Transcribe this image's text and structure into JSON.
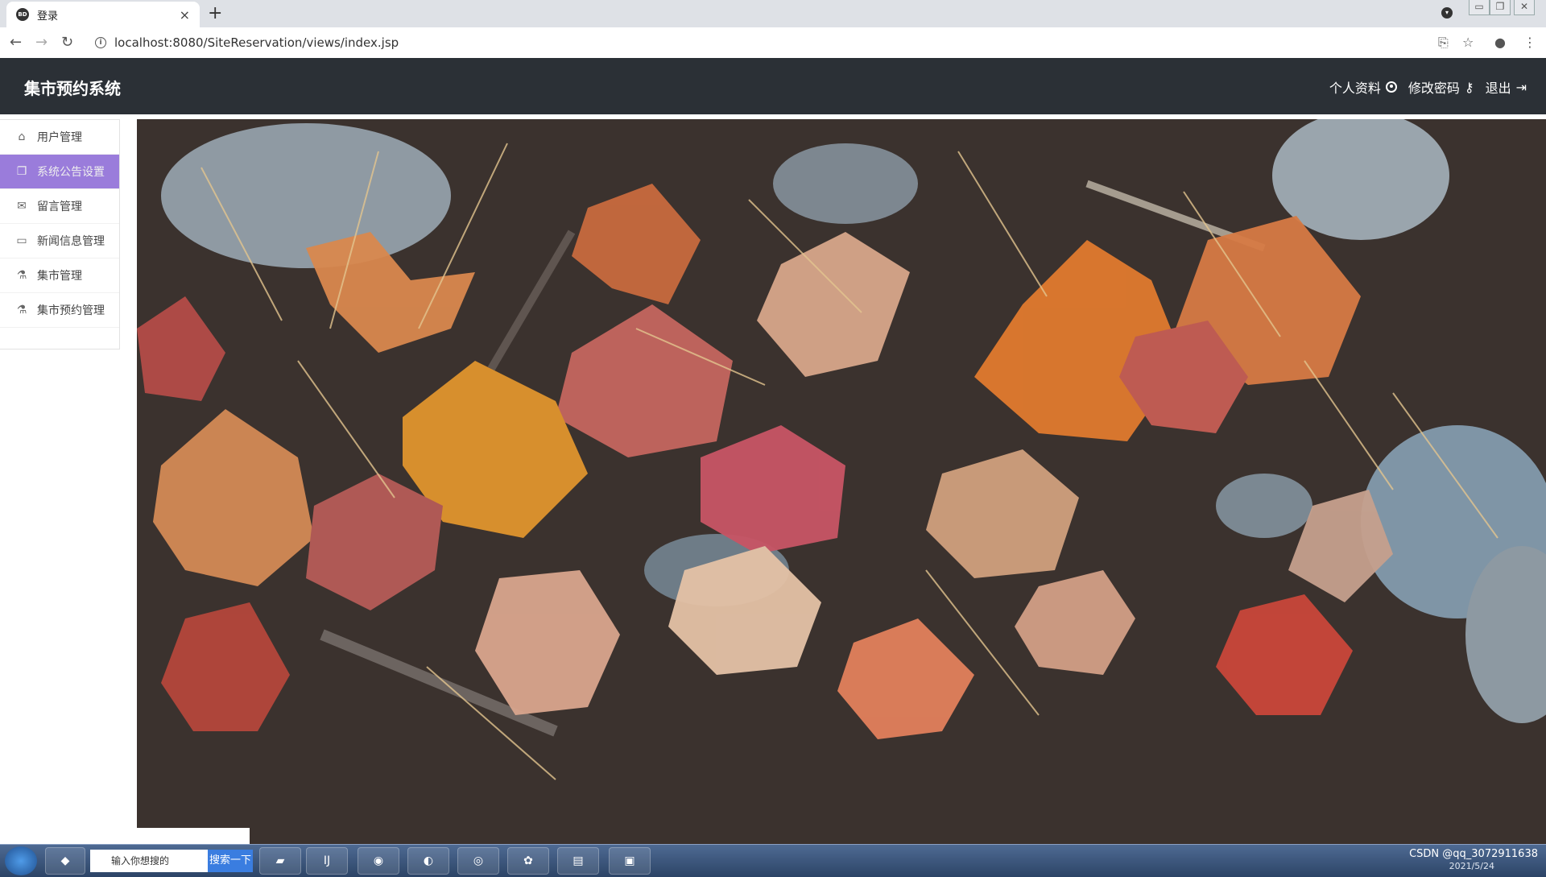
{
  "browser": {
    "tab_title": "登录",
    "favicon_text": "BD",
    "close_glyph": "×",
    "new_tab_glyph": "+",
    "url": "localhost:8080/SiteReservation/views/index.jsp"
  },
  "header": {
    "title": "集市预约系统",
    "links": [
      {
        "label": "个人资料",
        "icon": "user-circle-icon"
      },
      {
        "label": "修改密码",
        "icon": "key-icon"
      },
      {
        "label": "退出",
        "icon": "sign-out-icon"
      }
    ]
  },
  "sidebar": {
    "items": [
      {
        "label": "用户管理",
        "icon": "home-icon",
        "active": false
      },
      {
        "label": "系统公告设置",
        "icon": "copy-icon",
        "active": true
      },
      {
        "label": "留言管理",
        "icon": "envelope-icon",
        "active": false
      },
      {
        "label": "新闻信息管理",
        "icon": "monitor-icon",
        "active": false
      },
      {
        "label": "集市管理",
        "icon": "flask-icon",
        "active": false
      },
      {
        "label": "集市预约管理",
        "icon": "flask-icon",
        "active": false
      }
    ]
  },
  "taskbar": {
    "search_placeholder": "输入你想搜的",
    "search_button": "搜索一下",
    "tray_text": "CSDN @qq_3072911638",
    "date": "2021/5/24"
  },
  "colors": {
    "header_bg": "#2b3036",
    "sidebar_active": "#9a7cdb"
  }
}
